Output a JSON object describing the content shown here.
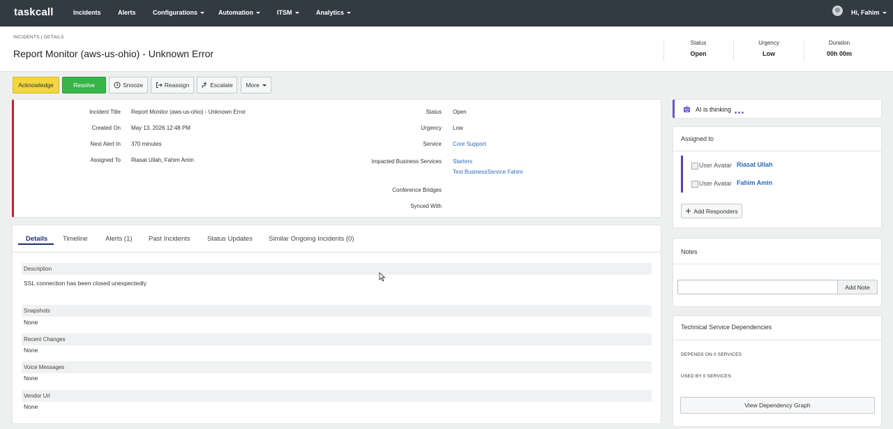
{
  "navbar": {
    "brand": "taskcall",
    "items": [
      {
        "label": "Incidents",
        "has_caret": false
      },
      {
        "label": "Alerts",
        "has_caret": false
      },
      {
        "label": "Configurations",
        "has_caret": true
      },
      {
        "label": "Automation",
        "has_caret": true
      },
      {
        "label": "ITSM",
        "has_caret": true
      },
      {
        "label": "Analytics",
        "has_caret": true
      }
    ],
    "user_greeting": "Hi, Fahim"
  },
  "header": {
    "breadcrumb": "INCIDENTS | DETAILS",
    "title": "Report Monitor (aws-us-ohio) - Unknown Error",
    "stats": [
      {
        "label": "Status",
        "value": "Open"
      },
      {
        "label": "Urgency",
        "value": "Low"
      },
      {
        "label": "Duration",
        "value": "00h 00m"
      }
    ]
  },
  "actions": {
    "acknowledge": "Acknowledge",
    "resolve": "Resolve",
    "snooze": "Snooze",
    "reassign": "Reassign",
    "escalate": "Escalate",
    "more": "More"
  },
  "details": {
    "left": [
      {
        "label": "Incident Title",
        "value": "Report Monitor (aws-us-ohio) - Unknown Error"
      },
      {
        "label": "Created On",
        "value": "May 13, 2026 12:48 PM"
      },
      {
        "label": "Next Alert In",
        "value": "370 minutes"
      },
      {
        "label": "Assigned To",
        "value": "Riasat Ullah, Fahim Amin"
      }
    ],
    "right": {
      "status_label": "Status",
      "status_value": "Open",
      "urgency_label": "Urgency",
      "urgency_value": "Low",
      "service_label": "Service",
      "service_value": "Core Support",
      "impacted_label": "Impacted Business Services",
      "impacted_values": [
        "Starters",
        "Test BusinessService Fahim"
      ],
      "bridges_label": "Conference Bridges",
      "synced_label": "Synced With"
    }
  },
  "tabs": [
    {
      "label": "Details",
      "active": true
    },
    {
      "label": "Timeline",
      "active": false
    },
    {
      "label": "Alerts (1)",
      "active": false
    },
    {
      "label": "Past Incidents",
      "active": false
    },
    {
      "label": "Status Updates",
      "active": false
    },
    {
      "label": "Similar Ongoing Incidents (0)",
      "active": false
    }
  ],
  "sections": [
    {
      "title": "Description",
      "body": "SSL connection has been closed unexpectedly"
    },
    {
      "title": "Snapshots",
      "body": "None"
    },
    {
      "title": "Recent Changes",
      "body": "None"
    },
    {
      "title": "Voice Messages",
      "body": "None"
    },
    {
      "title": "Vendor Url",
      "body": "None"
    }
  ],
  "ai": {
    "text": "AI is thinking"
  },
  "assigned": {
    "title": "Assigned to",
    "avatar_alt": "User Avatar",
    "people": [
      "Riasat Ullah",
      "Fahim Amin"
    ],
    "add_button": "Add Responders"
  },
  "notes": {
    "title": "Notes",
    "add_button": "Add Note",
    "input_value": ""
  },
  "dependencies": {
    "title": "Technical Service Dependencies",
    "depends_on": "DEPENDS ON 0 SERVICES",
    "used_by": "USED BY 0 SERVICES",
    "graph_button": "View Dependency Graph"
  },
  "colors": {
    "navbar": "#323b43",
    "acknowledge": "#f1d63f",
    "resolve": "#39b54a",
    "critical_border": "#cc1f2f",
    "ai_accent": "#6a55c8",
    "link": "#2a6ab8"
  }
}
